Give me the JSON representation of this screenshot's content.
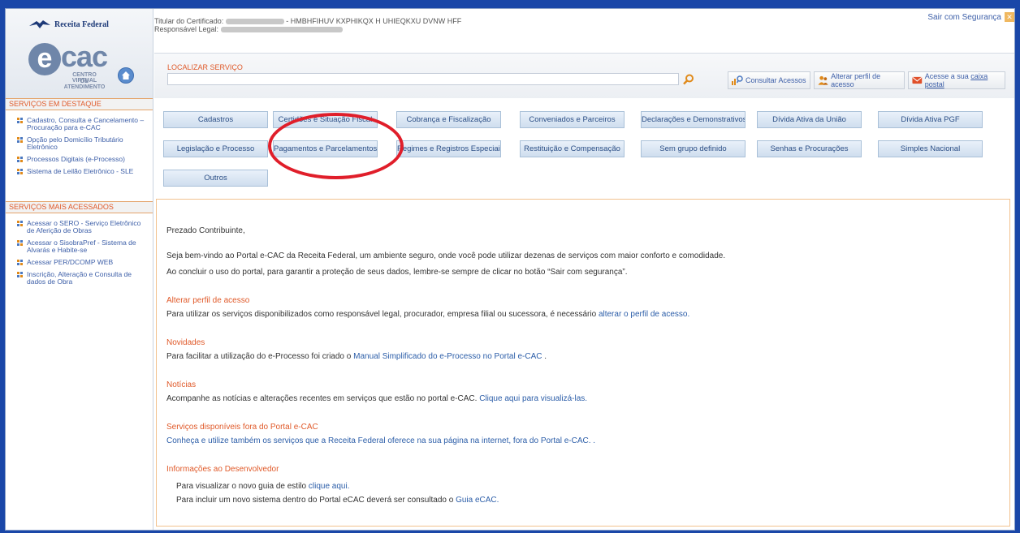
{
  "logo": {
    "brand": "Receita Federal",
    "ecac_letter": "e",
    "ecac_name": "cac",
    "subtitle_1": "CENTRO VIRTUAL",
    "subtitle_2": "DE ATENDIMENTO"
  },
  "cert": {
    "titular_label": "Titular do Certificado:",
    "titular_value": "- HMBHFIHUV KXPHIKQX H UHIEQKXU DVNW HFF",
    "responsavel_label": "Responsável Legal:"
  },
  "logout_label": "Sair com Segurança",
  "search": {
    "label": "LOCALIZAR SERVIÇO",
    "value": ""
  },
  "top_buttons": {
    "consultar": "Consultar Acessos",
    "alterar": "Alterar perfil de acesso",
    "caixa_prefix": "Acesse a sua ",
    "caixa_link": "caixa postal"
  },
  "sidebar": {
    "destaque_title": "SERVIÇOS EM DESTAQUE",
    "destaque": [
      "Cadastro, Consulta e Cancelamento – Procuração para e-CAC",
      "Opção pelo Domicílio Tributário Eletrônico",
      "Processos Digitais (e-Processo)",
      "Sistema de Leilão Eletrônico - SLE"
    ],
    "acessados_title": "SERVIÇOS MAIS ACESSADOS",
    "acessados": [
      "Acessar o SERO - Serviço Eletrônico de Aferição de Obras",
      "Acessar o SisobraPref - Sistema de Alvarás e Habite-se",
      "Acessar PER/DCOMP WEB",
      "Inscrição, Alteração e Consulta de dados de Obra"
    ]
  },
  "services": [
    [
      "Cadastros",
      "Certidões e Situação Fiscal",
      "Cobrança e Fiscalização",
      "Conveniados e Parceiros",
      "Declarações e Demonstrativos",
      "Dívida Ativa da União",
      "Dívida Ativa PGF"
    ],
    [
      "Legislação e Processo",
      "Pagamentos e Parcelamentos",
      "Regimes e Registros Especiais",
      "Restituição e Compensação",
      "Sem grupo definido",
      "Senhas e Procurações",
      "Simples Nacional"
    ],
    [
      "Outros"
    ]
  ],
  "welcome": {
    "greeting": "Prezado Contribuinte,",
    "intro_1": "Seja bem-vindo ao Portal e-CAC da Receita Federal, um ambiente seguro, onde você pode utilizar dezenas de serviços com maior conforto e comodidade.",
    "intro_2": "Ao concluir o uso do portal, para garantir a proteção de seus dados, lembre-se sempre de clicar no botão “Sair com segurança”.",
    "perfil_title": "Alterar perfil de acesso",
    "perfil_text": "Para utilizar os serviços disponibilizados como responsável legal, procurador, empresa filial ou sucessora, é necessário ",
    "perfil_link": "alterar o perfil de acesso.",
    "novidades_title": "Novidades",
    "novidades_text": "Para facilitar a utilização do e-Processo foi criado o ",
    "novidades_link": "Manual Simplificado do e-Processo no Portal e-CAC",
    "novidades_end": " .",
    "noticias_title": "Notícias",
    "noticias_text": "Acompanhe as notícias e alterações recentes em serviços que estão no portal e-CAC. ",
    "noticias_link": "Clique aqui para visualizá-las.",
    "fora_title": "Serviços disponíveis fora do Portal e-CAC",
    "fora_link": "Conheça e utilize também os serviços que a Receita Federal oferece na sua página na internet, fora do Portal e-CAC. .",
    "dev_title": "Informações ao Desenvolvedor",
    "dev_1_text": "Para visualizar o novo guia de estilo ",
    "dev_1_link": "clique aqui.",
    "dev_2_text": "Para incluir um novo sistema dentro do Portal eCAC deverá ser consultado o ",
    "dev_2_link": "Guia eCAC."
  },
  "colors": {
    "accent_orange": "#e05a2a",
    "link_blue": "#2b5da8",
    "highlight_red": "#e01e2a",
    "frame_blue": "#1a47a8"
  }
}
